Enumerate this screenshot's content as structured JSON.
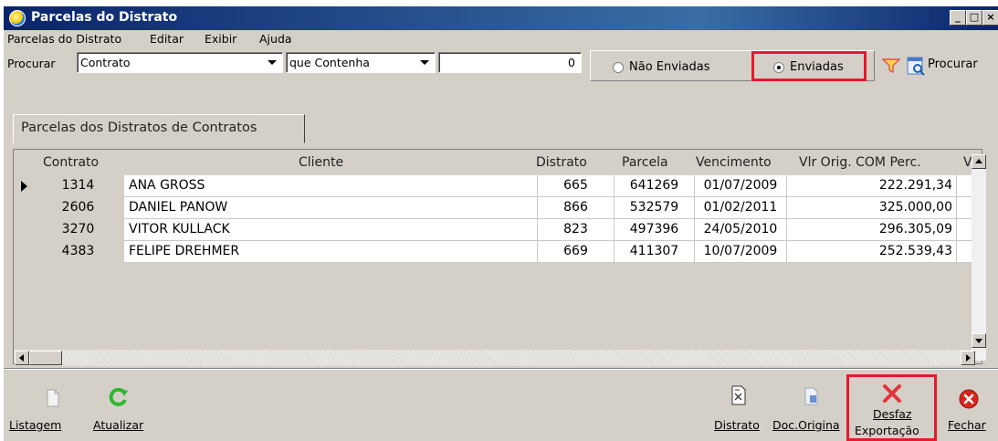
{
  "window": {
    "title": "Parcelas do Distrato"
  },
  "menu": [
    "Parcelas do Distrato",
    "Editar",
    "Exibir",
    "Ajuda"
  ],
  "search": {
    "label": "Procurar",
    "field": "Contrato",
    "operator": "que Contenha",
    "value": "0",
    "filter_options": [
      "Não Enviadas",
      "Enviadas"
    ],
    "selected_filter": "Enviadas",
    "search_label": "Procurar"
  },
  "tab": {
    "label": "Parcelas dos Distratos de Contratos"
  },
  "table": {
    "headers": [
      "Contrato",
      "Cliente",
      "Distrato",
      "Parcela",
      "Vencimento",
      "Vlr Orig. COM Perc.",
      "V"
    ],
    "rows": [
      [
        "1314",
        "ANA GROSS",
        "665",
        "641269",
        "01/07/2009",
        "222.291,34"
      ],
      [
        "2606",
        "DANIEL PANOW",
        "866",
        "532579",
        "01/02/2011",
        "325.000,00"
      ],
      [
        "3270",
        "VITOR KULLACK",
        "823",
        "497396",
        "24/05/2010",
        "296.305,09"
      ],
      [
        "4383",
        "FELIPE DREHMER",
        "669",
        "411307",
        "10/07/2009",
        "252.539,43"
      ]
    ]
  },
  "toolbar": {
    "listagem": "Listagem",
    "atualizar": "Atualizar",
    "distrato": "Distrato",
    "doc_original": "Doc.Origina",
    "desfaz_line1": "Desfaz",
    "desfaz_line2": "Exportação",
    "fechar": "Fechar"
  },
  "colors": {
    "highlight": "#e8192c",
    "titlebar": "#0a246a"
  }
}
